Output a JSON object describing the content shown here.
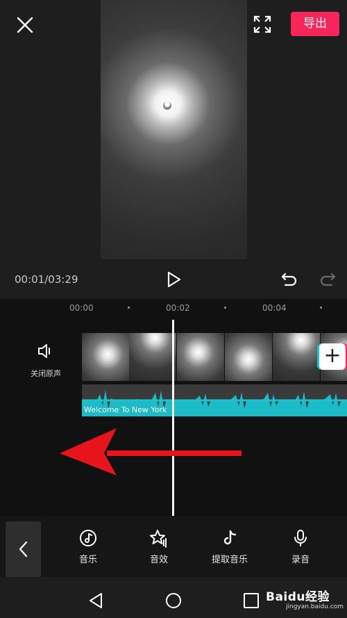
{
  "header": {
    "export_label": "导出"
  },
  "player": {
    "timecode": "00:01/03:29"
  },
  "timeline": {
    "ticks": [
      "00:00",
      "00:02",
      "00:04"
    ],
    "mute_label": "关闭原声",
    "audio_title": "Welcome To New York"
  },
  "toolbar": {
    "items": [
      {
        "label": "音乐",
        "icon": "music-icon"
      },
      {
        "label": "音效",
        "icon": "sound-effect-icon"
      },
      {
        "label": "提取音乐",
        "icon": "extract-music-icon"
      },
      {
        "label": "录音",
        "icon": "microphone-icon"
      }
    ]
  },
  "watermark": {
    "brand": "Baidu经验",
    "url": "jingyan.baidu.com"
  },
  "colors": {
    "accent": "#f6265a",
    "waveform": "#19c3cf",
    "annotation_arrow": "#e8141b"
  }
}
